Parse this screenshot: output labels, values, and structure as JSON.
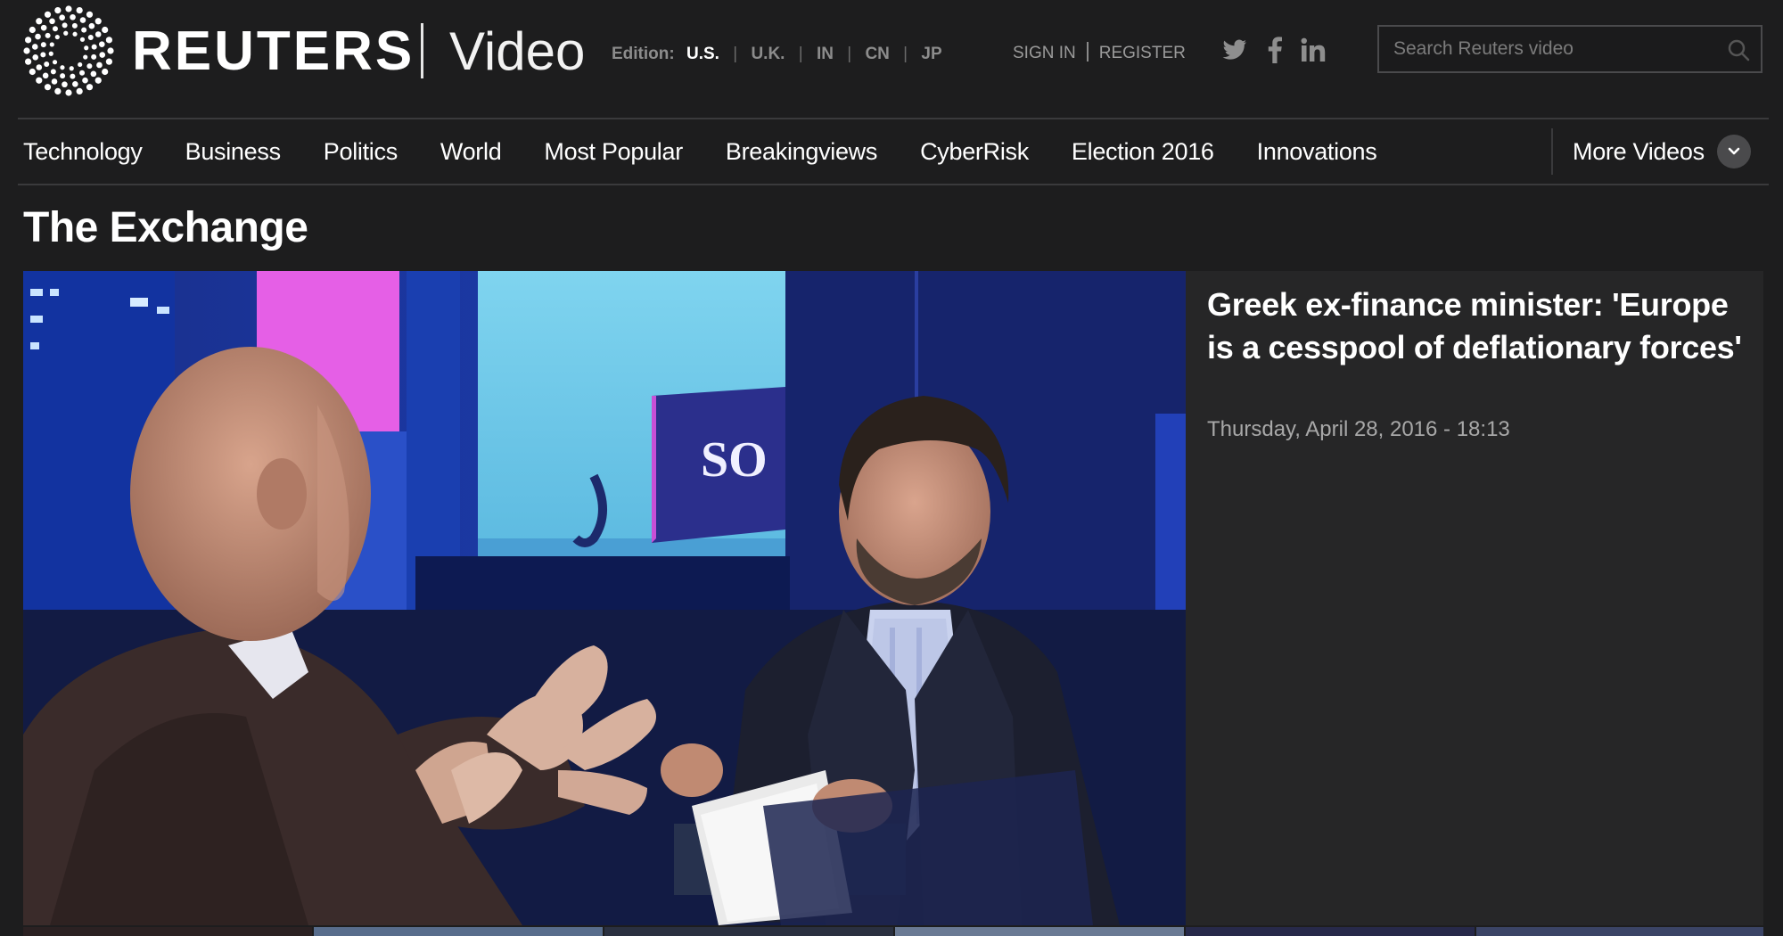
{
  "brand": {
    "name": "REUTERS",
    "section": "Video",
    "logo_icon": "reuters-dot-circle-logo"
  },
  "edition": {
    "label": "Edition:",
    "options": [
      "U.S.",
      "U.K.",
      "IN",
      "CN",
      "JP"
    ],
    "selected": "U.S."
  },
  "auth": {
    "sign_in": "SIGN IN",
    "register": "REGISTER"
  },
  "social": [
    "twitter-icon",
    "facebook-icon",
    "linkedin-icon"
  ],
  "search": {
    "placeholder": "Search Reuters video",
    "value": ""
  },
  "nav": {
    "items": [
      {
        "label": "Technology"
      },
      {
        "label": "Business"
      },
      {
        "label": "Politics"
      },
      {
        "label": "World"
      },
      {
        "label": "Most Popular"
      },
      {
        "label": "Breakingviews"
      },
      {
        "label": "CyberRisk"
      },
      {
        "label": "Election 2016"
      },
      {
        "label": "Innovations"
      }
    ],
    "more": "More Videos"
  },
  "section": {
    "title": "The Exchange"
  },
  "featured": {
    "headline": "Greek ex-finance minister: 'Europe is a cesspool of deflationary forces'",
    "timestamp": "Thursday, April 28, 2016 - 18:13",
    "screen_text": "SO"
  },
  "colors": {
    "background": "#1d1d1e",
    "panel": "#262627",
    "text": "#ffffff",
    "muted": "#a8a8a8"
  }
}
